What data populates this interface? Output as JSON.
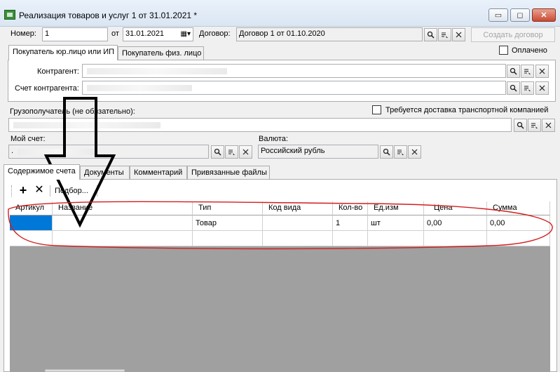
{
  "window": {
    "title": "Реализация товаров и услуг 1 от 31.01.2021 *",
    "minimize_glyph": "▭",
    "maximize_glyph": "◻",
    "close_glyph": "✕"
  },
  "header": {
    "number_label": "Номер:",
    "number_value": "1",
    "date_label": "от",
    "date_value": "31.01.2021",
    "contract_label": "Договор:",
    "contract_value": "Договор 1 от 01.10.2020",
    "create_contract_label": "Создать договор",
    "paid_label": "Оплачено"
  },
  "buyer_tabs": [
    {
      "label": "Покупатель юр.лицо или ИП",
      "active": true
    },
    {
      "label": "Покупатель физ. лицо",
      "active": false
    }
  ],
  "buyer": {
    "counterparty_label": "Контрагент:",
    "counterparty_value": "",
    "account_label": "Счет контрагента:",
    "account_value": ""
  },
  "consignee": {
    "label": "Грузополучатель (не обязательно):",
    "value": "",
    "delivery_label": "Требуется доставка транспортной компанией"
  },
  "my_account": {
    "label": "Мой счет:",
    "value": "."
  },
  "currency": {
    "label": "Валюта:",
    "value": "Российский рубль"
  },
  "content_tabs": [
    {
      "label": "Содержимое счета",
      "active": true
    },
    {
      "label": "Документы",
      "active": false
    },
    {
      "label": "Комментарий",
      "active": false
    },
    {
      "label": "Привязанные файлы",
      "active": false
    }
  ],
  "toolbar": {
    "add_glyph": "+",
    "delete_glyph": "✕",
    "select_label": "Подбор..."
  },
  "table": {
    "columns": [
      "Артикул",
      "Название",
      "Тип",
      "Код вида",
      "Кол-во",
      "Ед.изм",
      "Цена",
      "Сумма"
    ],
    "rows": [
      [
        "",
        "",
        "Товар",
        "",
        "1",
        "шт",
        "0,00",
        "0,00"
      ],
      [
        "",
        "",
        "",
        "",
        "",
        "",
        "",
        ""
      ]
    ]
  },
  "icons": {
    "search": "search-icon",
    "select_list": "select-list-icon",
    "clear": "clear-icon",
    "calendar": "calendar-icon"
  }
}
